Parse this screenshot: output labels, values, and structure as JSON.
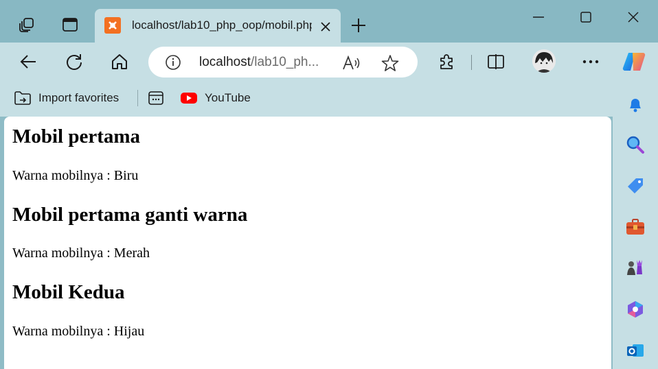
{
  "tab": {
    "title": "localhost/lab10_php_oop/mobil.php"
  },
  "address_bar": {
    "url_host": "localhost",
    "url_rest": "/lab10_ph..."
  },
  "bookmarks": {
    "items": [
      {
        "label": "Import favorites",
        "icon": "import-favorites-icon"
      },
      {
        "label": "",
        "icon": "app-launcher-icon"
      },
      {
        "label": "YouTube",
        "icon": "youtube-icon"
      }
    ]
  },
  "page": {
    "sections": [
      {
        "heading": "Mobil pertama",
        "text": "Warna mobilnya : Biru"
      },
      {
        "heading": "Mobil pertama ganti warna",
        "text": "Warna mobilnya : Merah"
      },
      {
        "heading": "Mobil Kedua",
        "text": "Warna mobilnya : Hijau"
      }
    ]
  },
  "colors": {
    "frame": "#88b8c3",
    "toolbar": "#c6dfe4",
    "page_background": "#ffffff",
    "favicon": "#f37021",
    "youtube": "#ff0000"
  }
}
